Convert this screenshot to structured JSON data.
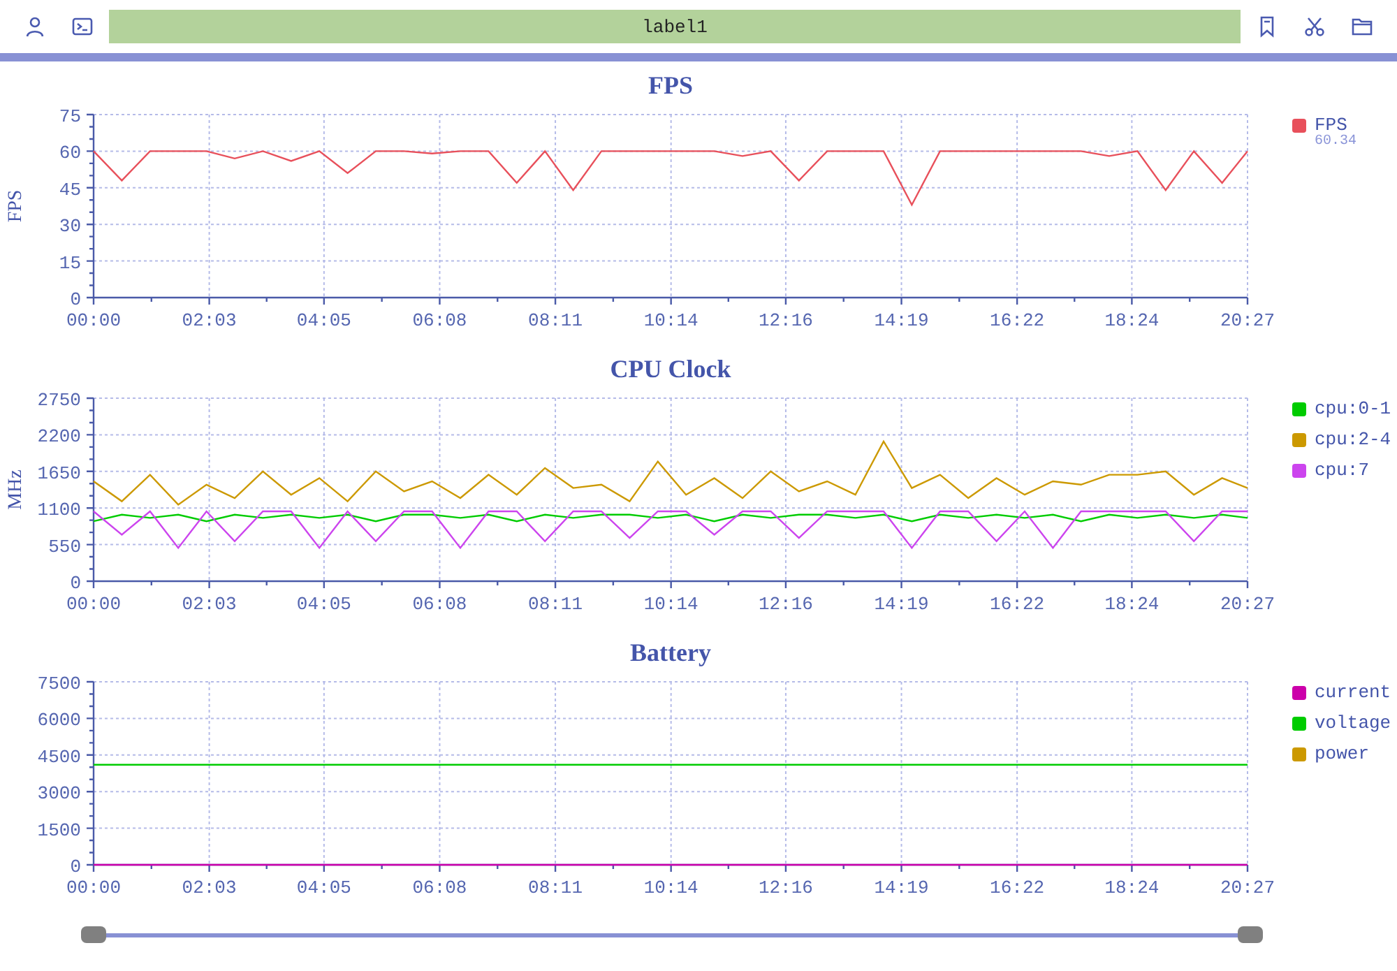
{
  "toolbar": {
    "label": "label1"
  },
  "range_slider": {
    "handles": [
      {
        "level": 0
      },
      {
        "level": 1
      }
    ]
  },
  "charts": [
    {
      "legend_reading": "60.34",
      "chart_data": {
        "type": "line",
        "grid": true,
        "title": "FPS",
        "ylabel": "FPS",
        "ylim": [
          0,
          75
        ],
        "xlim": [
          0,
          1227
        ],
        "yticks": [
          0,
          15,
          30,
          45,
          60,
          75
        ],
        "xticks": [
          {
            "value": 0,
            "label": "00:00"
          },
          {
            "value": 123,
            "label": "02:03"
          },
          {
            "value": 245,
            "label": "04:05"
          },
          {
            "value": 368,
            "label": "06:08"
          },
          {
            "value": 491,
            "label": "08:11"
          },
          {
            "value": 614,
            "label": "10:14"
          },
          {
            "value": 736,
            "label": "12:16"
          },
          {
            "value": 859,
            "label": "14:19"
          },
          {
            "value": 982,
            "label": "16:22"
          },
          {
            "value": 1104,
            "label": "18:24"
          },
          {
            "value": 1227,
            "label": "20:27"
          }
        ],
        "x": [
          0,
          30,
          60,
          90,
          120,
          150,
          180,
          210,
          240,
          270,
          300,
          330,
          360,
          390,
          420,
          450,
          480,
          510,
          540,
          570,
          600,
          630,
          660,
          690,
          720,
          750,
          780,
          810,
          840,
          870,
          900,
          930,
          960,
          990,
          1020,
          1050,
          1080,
          1110,
          1140,
          1170,
          1200,
          1227
        ],
        "series": [
          {
            "name": "FPS",
            "color": "#e8505b",
            "values": [
              60,
              48,
              60,
              60,
              60,
              57,
              60,
              56,
              60,
              51,
              60,
              60,
              59,
              60,
              60,
              47,
              60,
              44,
              60,
              60,
              60,
              60,
              60,
              58,
              60,
              48,
              60,
              60,
              60,
              38,
              60,
              60,
              60,
              60,
              60,
              60,
              58,
              60,
              44,
              60,
              47,
              60
            ]
          }
        ]
      }
    },
    {
      "chart_data": {
        "type": "line",
        "grid": true,
        "title": "CPU Clock",
        "ylabel": "MHz",
        "ylim": [
          0,
          2750
        ],
        "xlim": [
          0,
          1227
        ],
        "yticks": [
          0,
          550,
          1100,
          1650,
          2200,
          2750
        ],
        "xticks": [
          {
            "value": 0,
            "label": "00:00"
          },
          {
            "value": 123,
            "label": "02:03"
          },
          {
            "value": 245,
            "label": "04:05"
          },
          {
            "value": 368,
            "label": "06:08"
          },
          {
            "value": 491,
            "label": "08:11"
          },
          {
            "value": 614,
            "label": "10:14"
          },
          {
            "value": 736,
            "label": "12:16"
          },
          {
            "value": 859,
            "label": "14:19"
          },
          {
            "value": 982,
            "label": "16:22"
          },
          {
            "value": 1104,
            "label": "18:24"
          },
          {
            "value": 1227,
            "label": "20:27"
          }
        ],
        "x": [
          0,
          30,
          60,
          90,
          120,
          150,
          180,
          210,
          240,
          270,
          300,
          330,
          360,
          390,
          420,
          450,
          480,
          510,
          540,
          570,
          600,
          630,
          660,
          690,
          720,
          750,
          780,
          810,
          840,
          870,
          900,
          930,
          960,
          990,
          1020,
          1050,
          1080,
          1110,
          1140,
          1170,
          1200,
          1227
        ],
        "series": [
          {
            "name": "cpu:0-1",
            "color": "#00cc00",
            "values": [
              900,
              1000,
              950,
              1000,
              900,
              1000,
              950,
              1000,
              950,
              1000,
              900,
              1000,
              1000,
              950,
              1000,
              900,
              1000,
              950,
              1000,
              1000,
              950,
              1000,
              900,
              1000,
              950,
              1000,
              1000,
              950,
              1000,
              900,
              1000,
              950,
              1000,
              950,
              1000,
              900,
              1000,
              950,
              1000,
              950,
              1000,
              950
            ]
          },
          {
            "name": "cpu:2-4",
            "color": "#cc9900",
            "values": [
              1500,
              1200,
              1600,
              1150,
              1450,
              1250,
              1650,
              1300,
              1550,
              1200,
              1650,
              1350,
              1500,
              1250,
              1600,
              1300,
              1700,
              1400,
              1450,
              1200,
              1800,
              1300,
              1550,
              1250,
              1650,
              1350,
              1500,
              1300,
              2100,
              1400,
              1600,
              1250,
              1550,
              1300,
              1500,
              1450,
              1600,
              1600,
              1650,
              1300,
              1550,
              1400
            ]
          },
          {
            "name": "cpu:7",
            "color": "#cc44ee",
            "values": [
              1050,
              700,
              1050,
              500,
              1050,
              600,
              1050,
              1050,
              500,
              1050,
              600,
              1050,
              1050,
              500,
              1050,
              1050,
              600,
              1050,
              1050,
              650,
              1050,
              1050,
              700,
              1050,
              1050,
              650,
              1050,
              1050,
              1050,
              500,
              1050,
              1050,
              600,
              1050,
              500,
              1050,
              1050,
              1050,
              1050,
              600,
              1050,
              1050
            ]
          }
        ]
      }
    },
    {
      "chart_data": {
        "type": "line",
        "grid": true,
        "title": "Battery",
        "ylim": [
          0,
          7500
        ],
        "xlim": [
          0,
          1227
        ],
        "yticks": [
          0,
          1500,
          3000,
          4500,
          6000,
          7500
        ],
        "xticks": [
          {
            "value": 0,
            "label": "00:00"
          },
          {
            "value": 123,
            "label": "02:03"
          },
          {
            "value": 245,
            "label": "04:05"
          },
          {
            "value": 368,
            "label": "06:08"
          },
          {
            "value": 491,
            "label": "08:11"
          },
          {
            "value": 614,
            "label": "10:14"
          },
          {
            "value": 736,
            "label": "12:16"
          },
          {
            "value": 859,
            "label": "14:19"
          },
          {
            "value": 982,
            "label": "16:22"
          },
          {
            "value": 1104,
            "label": "18:24"
          },
          {
            "value": 1227,
            "label": "20:27"
          }
        ],
        "x": [
          0,
          30,
          60,
          90,
          120,
          150,
          180,
          210,
          240,
          270,
          300,
          330,
          360,
          390,
          420,
          450,
          480,
          510,
          540,
          570,
          600,
          630,
          660,
          690,
          720,
          750,
          780,
          810,
          840,
          870,
          900,
          930,
          960,
          990,
          1020,
          1050,
          1080,
          1110,
          1140,
          1170,
          1200,
          1227
        ],
        "series": [
          {
            "name": "current",
            "color": "#cc00aa",
            "values": [
              0,
              0,
              0,
              0,
              0,
              0,
              0,
              0,
              0,
              0,
              0,
              0,
              0,
              0,
              0,
              0,
              0,
              0,
              0,
              0,
              0,
              0,
              0,
              0,
              0,
              0,
              0,
              0,
              0,
              0,
              0,
              0,
              0,
              0,
              0,
              0,
              0,
              0,
              0,
              0,
              0,
              0
            ]
          },
          {
            "name": "voltage",
            "color": "#00cc00",
            "values": [
              4100,
              4100,
              4100,
              4100,
              4100,
              4100,
              4100,
              4100,
              4100,
              4100,
              4100,
              4100,
              4100,
              4100,
              4100,
              4100,
              4100,
              4100,
              4100,
              4100,
              4100,
              4100,
              4100,
              4100,
              4100,
              4100,
              4100,
              4100,
              4100,
              4100,
              4100,
              4100,
              4100,
              4100,
              4100,
              4100,
              4100,
              4100,
              4100,
              4100,
              4100,
              4100
            ]
          },
          {
            "name": "power",
            "color": "#cc9900",
            "values": [
              null,
              null,
              null,
              null,
              null,
              null,
              null,
              null,
              null,
              null,
              null,
              null,
              null,
              null,
              null,
              null,
              null,
              null,
              null,
              null,
              null,
              null,
              null,
              null,
              null,
              null,
              null,
              null,
              null,
              null,
              null,
              null,
              null,
              null,
              null,
              null,
              null,
              null,
              null,
              null,
              null,
              null
            ]
          }
        ]
      }
    }
  ]
}
